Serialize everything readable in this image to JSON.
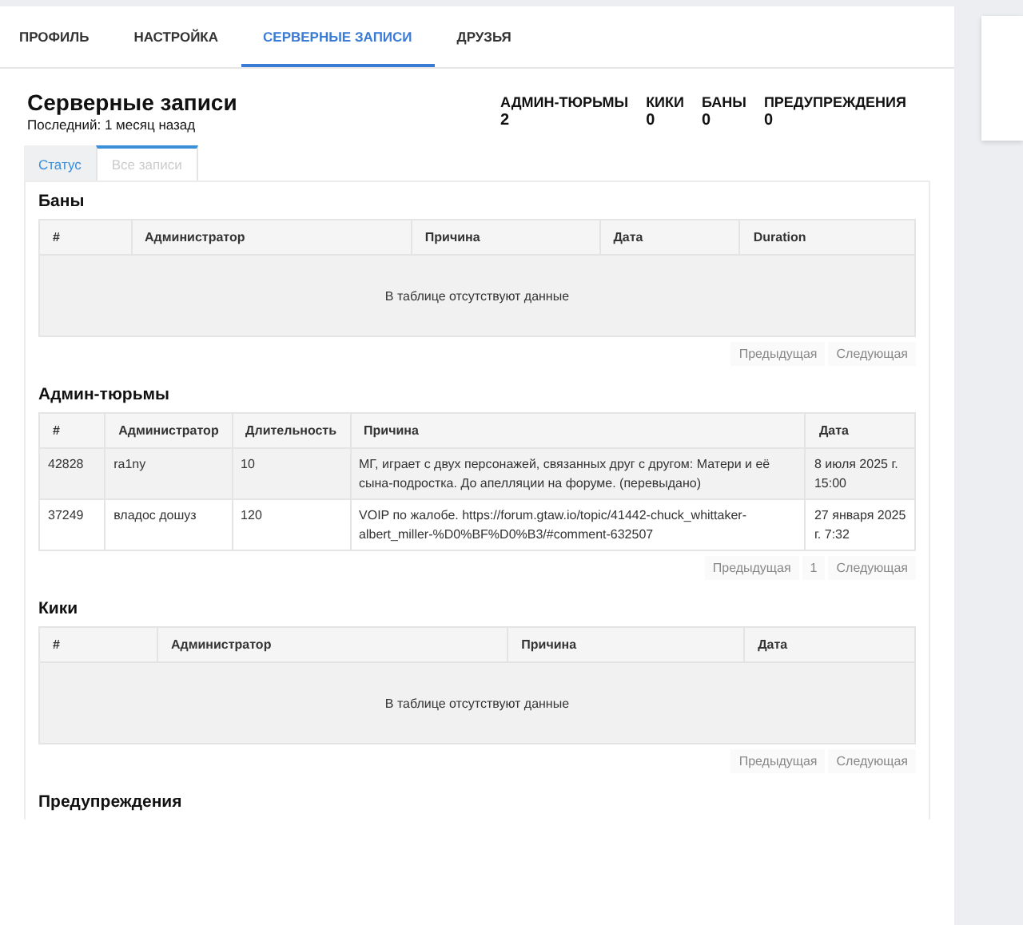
{
  "nav_tabs": [
    {
      "label": "ПРОФИЛЬ",
      "selected": false
    },
    {
      "label": "НАСТРОЙКА",
      "selected": false
    },
    {
      "label": "СЕРВЕРНЫЕ ЗАПИСИ",
      "selected": true
    },
    {
      "label": "ДРУЗЬЯ",
      "selected": false
    }
  ],
  "header": {
    "title": "Серверные записи",
    "subtitle": "Последний: 1 месяц назад"
  },
  "stats": [
    {
      "label": "АДМИН-ТЮРЬМЫ",
      "value": "2"
    },
    {
      "label": "КИКИ",
      "value": "0"
    },
    {
      "label": "БАНЫ",
      "value": "0"
    },
    {
      "label": "ПРЕДУПРЕЖДЕНИЯ",
      "value": "0"
    }
  ],
  "sub_tabs": [
    {
      "label": "Статус",
      "selected": false
    },
    {
      "label": "Все записи",
      "selected": true
    }
  ],
  "sections": [
    {
      "title": "Баны",
      "columns": [
        "#",
        "Администратор",
        "Причина",
        "Дата",
        "Duration"
      ],
      "empty_text": "В таблице отсутствуют данные",
      "pagination": {
        "previous": "Предыдущая",
        "next": "Следующая",
        "disabled": true
      }
    },
    {
      "title": "Админ-тюрьмы",
      "columns": [
        "#",
        "Администратор",
        "Длительность",
        "Причина",
        "Дата"
      ],
      "rows": [
        [
          "42828",
          "ra1ny",
          "10",
          "МГ, играет с двух персонажей, связанных друг с другом: Матери и её сына-подростка. До апелляции на форуме. (перевыдано)",
          "8 июля 2025 г. 15:00"
        ],
        [
          "37249",
          "владос дошуз",
          "120",
          "VOIP по жалобе. https://forum.gtaw.io/topic/41442-chuck_whittaker-albert_miller-%D0%BF%D0%B3/#comment-632507",
          "27 января 2025 г. 7:32"
        ]
      ],
      "pagination": {
        "previous": "Предыдущая",
        "pages": [
          "1"
        ],
        "next": "Следующая",
        "disabled": true
      }
    },
    {
      "title": "Кики",
      "columns": [
        "#",
        "Администратор",
        "Причина",
        "Дата"
      ],
      "empty_text": "В таблице отсутствуют данные",
      "pagination": {
        "previous": "Предыдущая",
        "next": "Следующая",
        "disabled": true
      }
    },
    {
      "title": "Предупреждения"
    }
  ]
}
